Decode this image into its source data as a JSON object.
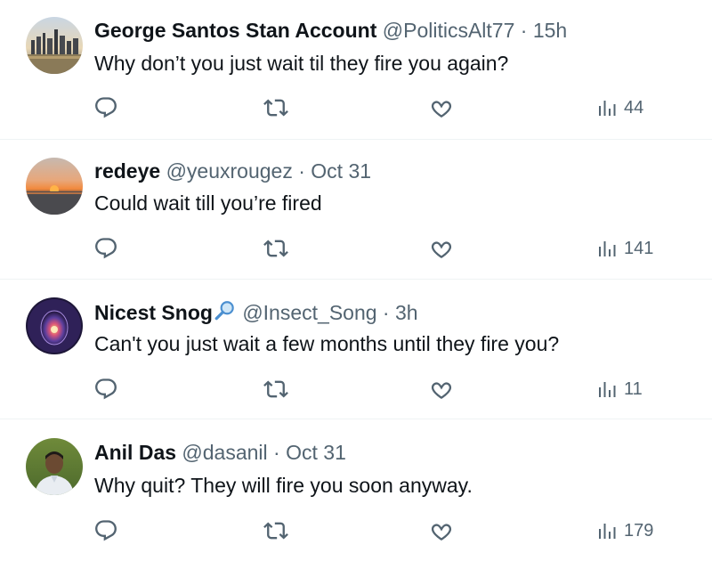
{
  "tweets": [
    {
      "name": "George Santos Stan Account",
      "badge": "",
      "handle": "@PoliticsAlt77",
      "separator": "·",
      "time": "15h",
      "text": "Why don’t you just wait til they fire you again?",
      "views": "44",
      "avatar_icon": "city-skyline-avatar"
    },
    {
      "name": "redeye",
      "badge": "",
      "handle": "@yeuxrougez",
      "separator": "·",
      "time": "Oct 31",
      "text": "Could wait till you’re fired",
      "views": "141",
      "avatar_icon": "sunset-avatar"
    },
    {
      "name": "Nicest Snog",
      "badge": "magnifying-glass-icon",
      "handle": "@Insect_Song",
      "separator": "·",
      "time": "3h",
      "text": "Can't you just wait a few months until they fire you?",
      "views": "11",
      "avatar_icon": "cosmic-egg-avatar"
    },
    {
      "name": "Anil Das",
      "badge": "",
      "handle": "@dasanil",
      "separator": "·",
      "time": "Oct 31",
      "text": "Why quit? They will fire you soon anyway.",
      "views": "179",
      "avatar_icon": "person-photo-avatar"
    }
  ],
  "icons": {
    "reply": "reply-icon",
    "retweet": "retweet-icon",
    "like": "heart-icon",
    "views": "views-bar-icon"
  },
  "colors": {
    "text_primary": "#0f1419",
    "text_secondary": "#536471",
    "divider": "#eff3f4"
  }
}
